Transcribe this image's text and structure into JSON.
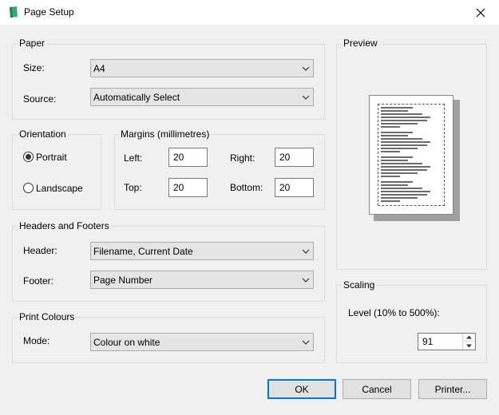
{
  "window": {
    "title": "Page Setup"
  },
  "paper": {
    "group_title": "Paper",
    "size_label": "Size:",
    "size_value": "A4",
    "source_label": "Source:",
    "source_value": "Automatically Select"
  },
  "orientation": {
    "group_title": "Orientation",
    "portrait_label": "Portrait",
    "landscape_label": "Landscape",
    "selected": "Portrait"
  },
  "margins": {
    "group_title": "Margins (millimetres)",
    "left_label": "Left:",
    "left_value": "20",
    "right_label": "Right:",
    "right_value": "20",
    "top_label": "Top:",
    "top_value": "20",
    "bottom_label": "Bottom:",
    "bottom_value": "20"
  },
  "headers_footers": {
    "group_title": "Headers and Footers",
    "header_label": "Header:",
    "header_value": "Filename, Current Date",
    "footer_label": "Footer:",
    "footer_value": "Page Number"
  },
  "print_colours": {
    "group_title": "Print Colours",
    "mode_label": "Mode:",
    "mode_value": "Colour on white"
  },
  "preview": {
    "group_title": "Preview"
  },
  "scaling": {
    "group_title": "Scaling",
    "level_label": "Level (10% to 500%):",
    "level_value": "91"
  },
  "buttons": {
    "ok": "OK",
    "cancel": "Cancel",
    "printer": "Printer..."
  },
  "colors": {
    "accent": "#0078d7",
    "app_icon": "#3aa776"
  },
  "icons": [
    "app-icon",
    "close-icon",
    "chevron-down-icon",
    "spin-up-icon",
    "spin-down-icon"
  ]
}
